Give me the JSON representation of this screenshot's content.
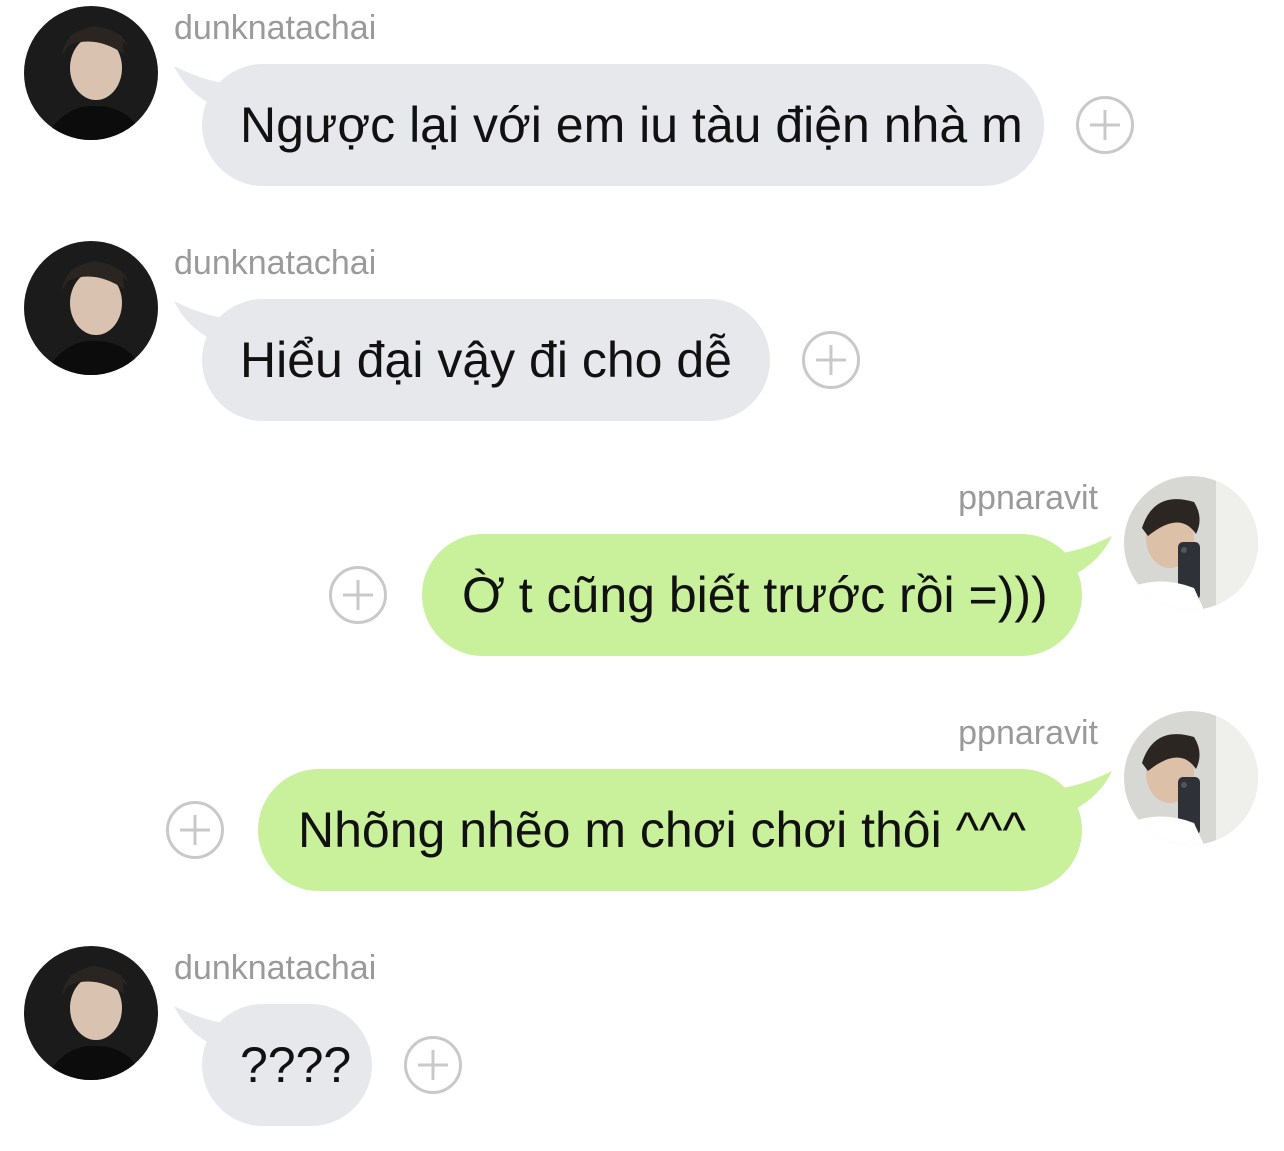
{
  "conversation": {
    "messages": [
      {
        "sender": "dunknatachai",
        "text": "Ngược lại với em iu tàu điện nhà m",
        "direction": "incoming"
      },
      {
        "sender": "dunknatachai",
        "text": "Hiểu đại vậy đi cho dễ",
        "direction": "incoming"
      },
      {
        "sender": "ppnaravit",
        "text": "Ờ t cũng biết trước rồi =)))",
        "direction": "outgoing"
      },
      {
        "sender": "ppnaravit",
        "text": "Nhõng nhẽo m chơi chơi thôi ^^^",
        "direction": "outgoing"
      },
      {
        "sender": "dunknatachai",
        "text": "????",
        "direction": "incoming"
      }
    ]
  },
  "colors": {
    "incoming_bubble": "#e6e8ec",
    "outgoing_bubble": "#c9f09b",
    "sender_name": "#9a9a9a",
    "add_button": "#c9c9c9"
  },
  "icons": {
    "add_reaction": "plus-circle-icon"
  }
}
